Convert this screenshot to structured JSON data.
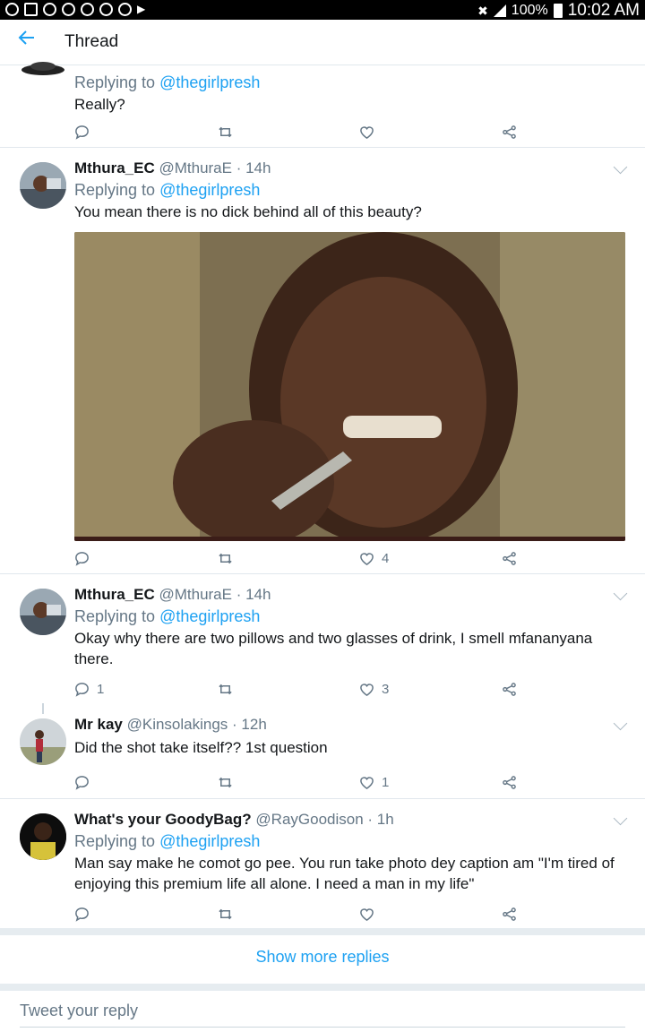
{
  "status_bar": {
    "battery": "100%",
    "time": "10:02 AM"
  },
  "app_bar": {
    "title": "Thread"
  },
  "tweets": [
    {
      "reply_prefix": "Replying to",
      "reply_handle": "@thegirlpresh",
      "text": "Really?",
      "replies": "",
      "likes": ""
    },
    {
      "name": "Mthura_EC",
      "handle": "@MthuraE",
      "time": "· 14h",
      "reply_prefix": "Replying to",
      "reply_handle": "@thegirlpresh",
      "text": "You mean there is no dick behind all of this beauty?",
      "replies": "",
      "likes": "4"
    },
    {
      "name": "Mthura_EC",
      "handle": "@MthuraE",
      "time": "· 14h",
      "reply_prefix": "Replying to",
      "reply_handle": "@thegirlpresh",
      "text": "Okay why there are two pillows and two glasses of drink, I smell mfananyana there.",
      "replies": "1",
      "likes": "3"
    },
    {
      "name": "Mr kay",
      "handle": "@Kinsolakings",
      "time": "· 12h",
      "text": "Did the shot take itself?? 1st question",
      "replies": "",
      "likes": "1"
    },
    {
      "name": "What's your GoodyBag?",
      "handle": "@RayGoodison",
      "time": "· 1h",
      "reply_prefix": "Replying to",
      "reply_handle": "@thegirlpresh",
      "text": "Man say make he comot go pee. You run take photo dey caption am \"I'm tired of enjoying this premium life all alone. I need a man in my life\"",
      "replies": "",
      "likes": ""
    }
  ],
  "show_more": "Show more replies",
  "reply_placeholder": "Tweet your reply",
  "colors": {
    "accent": "#1da1f2",
    "secondary": "#657786",
    "divider": "#e1e8ed"
  }
}
